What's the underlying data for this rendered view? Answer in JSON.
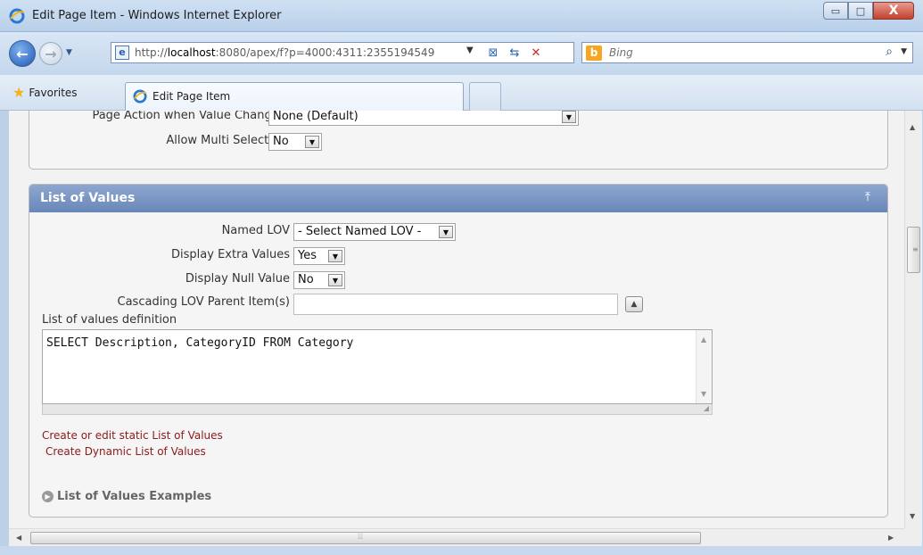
{
  "window": {
    "title": "Edit Page Item - Windows Internet Explorer",
    "minimize_glyph": "▭",
    "maximize_glyph": "□",
    "close_glyph": "X"
  },
  "addressbar": {
    "url_prefix": "http://",
    "url_host": "localhost",
    "url_rest": ":8080/apex/f?p=4000:4311:2355194549",
    "search_placeholder": "Bing"
  },
  "favorites": {
    "label": "Favorites"
  },
  "tabs": [
    {
      "label": "Edit Page Item"
    }
  ],
  "top_section": {
    "page_action_label": "Page Action when Value Changed",
    "page_action_value": "None (Default)",
    "multi_select_label": "Allow Multi Selection",
    "multi_select_value": "No"
  },
  "lov_section": {
    "title": "List of Values",
    "named_lov_label": "Named LOV",
    "named_lov_value": "- Select Named LOV -",
    "extra_values_label": "Display Extra Values",
    "extra_values_value": "Yes",
    "null_value_label": "Display Null Value",
    "null_value_value": "No",
    "cascading_label": "Cascading LOV Parent Item(s)",
    "cascading_value": "",
    "definition_label": "List of values definition",
    "definition_value": "SELECT Description, CategoryID FROM Category",
    "link_static": "Create or edit static List of Values",
    "link_dynamic": "Create Dynamic List of Values",
    "examples_label": "List of Values Examples"
  },
  "colors": {
    "section_header": "#7592c2",
    "link": "#8b1a1a"
  },
  "icons": {
    "browser": "ie-icon",
    "back": "back-arrow-icon",
    "forward": "forward-arrow-icon",
    "compat": "compatibility-view-icon",
    "refresh": "refresh-icon",
    "stop": "stop-icon",
    "search": "search-icon",
    "favorites": "star-icon",
    "collapse": "collapse-up-icon",
    "examples": "expand-circle-icon"
  }
}
